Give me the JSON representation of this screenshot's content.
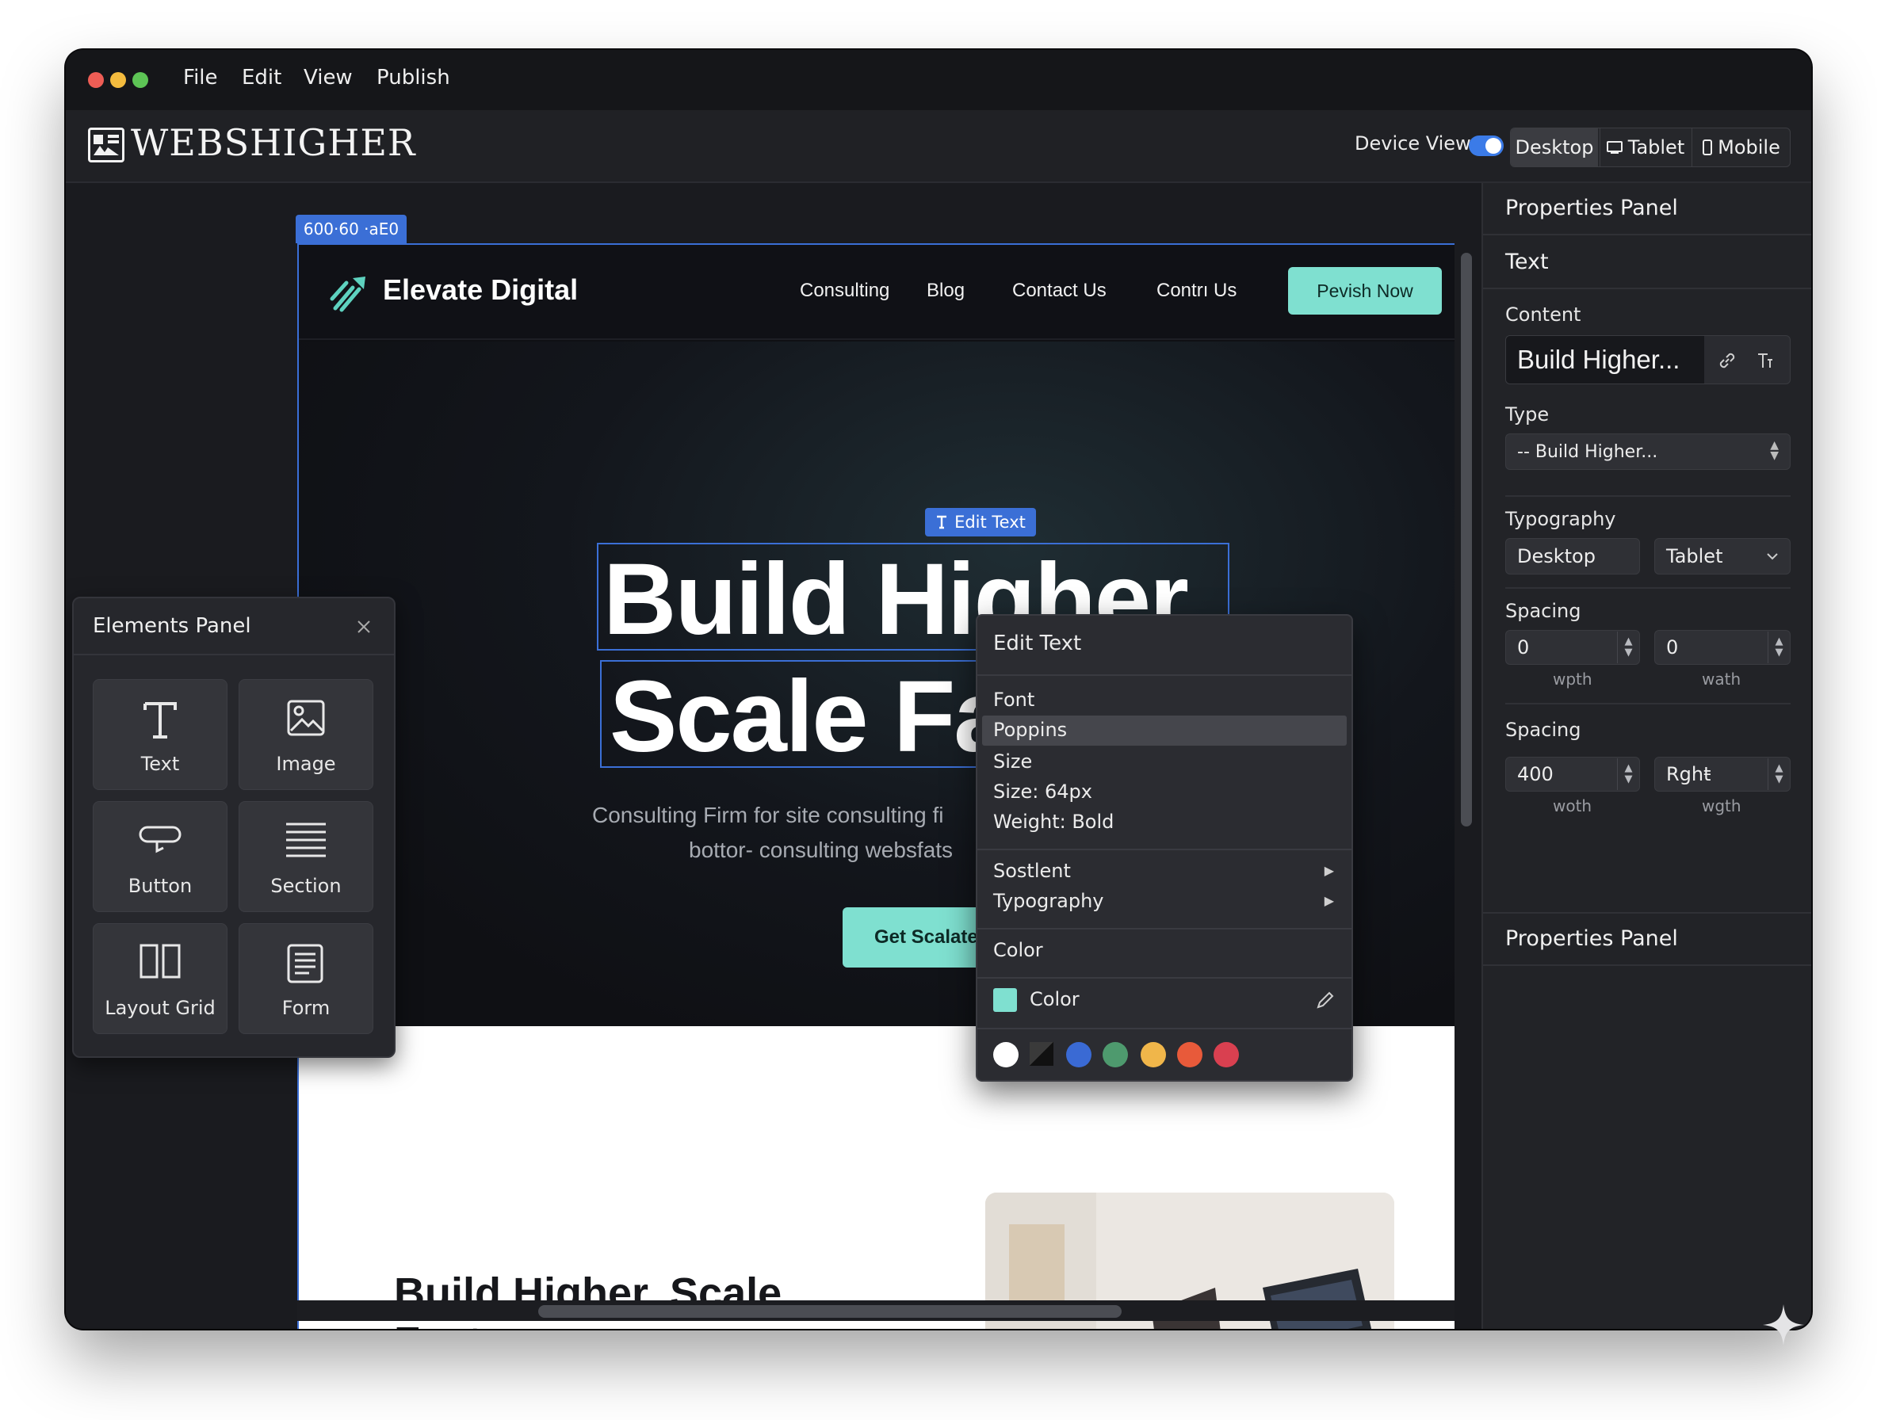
{
  "menubar": {
    "items": [
      "File",
      "Edit",
      "View",
      "Publish"
    ]
  },
  "app": {
    "logo": "WEBSHIGHER",
    "device_view_label": "Device View",
    "device_view_toggle": true,
    "devices": [
      "Desktop",
      "Tablet",
      "Mobile"
    ],
    "active_device": "Desktop"
  },
  "canvas": {
    "size_tag": "600·60 ·aE0",
    "edit_text_tag": "Edit Text",
    "site": {
      "brand": "Elevate Digital",
      "nav": [
        "Consulting",
        "Blog",
        "Contact Us",
        "Contrı Us"
      ],
      "nav_cta": "Pevish Now",
      "hero_line1": "Build Higher.",
      "hero_line2": "Scale Fa",
      "hero_sub1": "Consulting Firm for site consulting fi",
      "hero_sub2": "bottor- consulting websfats",
      "hero_cta": "Get Scalated From",
      "section_heading": "Build Higher. Scale Faster"
    }
  },
  "elements_panel": {
    "title": "Elements Panel",
    "items": [
      {
        "label": "Text",
        "icon": "text-icon"
      },
      {
        "label": "Image",
        "icon": "image-icon"
      },
      {
        "label": "Button",
        "icon": "button-icon"
      },
      {
        "label": "Section",
        "icon": "section-icon"
      },
      {
        "label": "Layout Grid",
        "icon": "layout-grid-icon"
      },
      {
        "label": "Form",
        "icon": "form-icon"
      }
    ]
  },
  "context_menu": {
    "title": "Edit Text",
    "font_label": "Font",
    "font_value": "Poppins",
    "size_label": "Size",
    "size_value": "Size: 64px",
    "weight": "Weight: Bold",
    "submenu1": "Sostlent",
    "submenu2": "Typography",
    "color_section": "Color",
    "color_label": "Color",
    "swatches": [
      "#ffffff",
      "#1e1e1e",
      "#3a6ad4",
      "#4e9a6e",
      "#f0b64a",
      "#e85a3a",
      "#d94050"
    ]
  },
  "properties": {
    "title": "Properties Panel",
    "section": "Text",
    "content_label": "Content",
    "content_value": "Build Higher...",
    "type_label": "Type",
    "type_value": "-- Build Higher...",
    "typography_label": "Typography",
    "typography_left": "Desktop",
    "typography_right": "Tablet",
    "spacing1_label": "Spacing",
    "spacing1": [
      {
        "value": "0",
        "sub": "wpth"
      },
      {
        "value": "0",
        "sub": "wath"
      }
    ],
    "spacing2_label": "Spacing",
    "spacing2": [
      {
        "value": "400",
        "sub": "woth"
      },
      {
        "value": "Rghŧ",
        "sub": "wgth"
      }
    ],
    "footer_title": "Properties Panel"
  },
  "colors": {
    "accent": "#3b6fd6",
    "cta": "#7fe0d0",
    "panel": "#222327"
  }
}
